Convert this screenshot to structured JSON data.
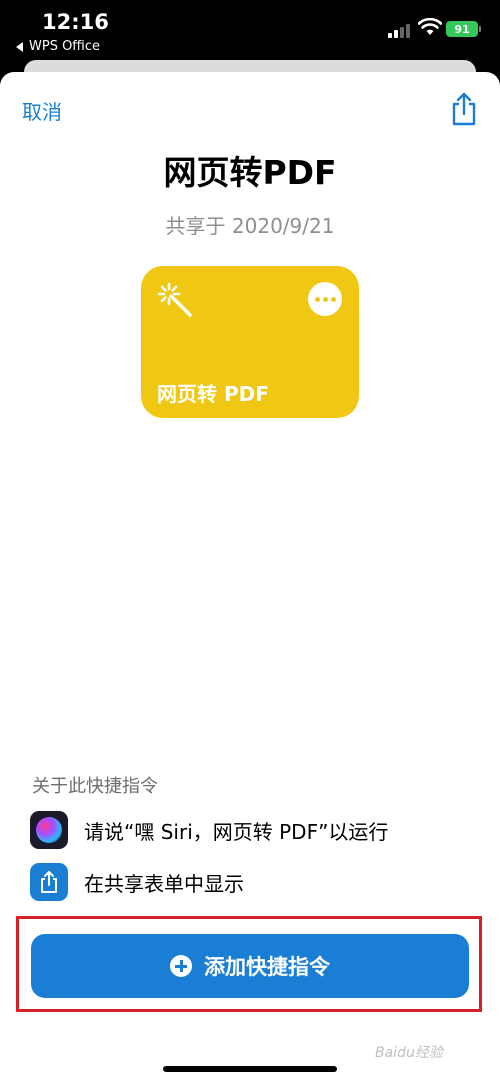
{
  "status_bar": {
    "time": "12:16",
    "back_app": "WPS Office",
    "battery": "91"
  },
  "nav": {
    "cancel": "取消",
    "share_icon": "share-icon"
  },
  "shortcut": {
    "title": "网页转PDF",
    "shared_on": "共享于 2020/9/21",
    "card_name": "网页转 PDF",
    "card_color": "#f0c814",
    "card_icon": "magic-wand-icon",
    "more_icon": "ellipsis-icon"
  },
  "about": {
    "header": "关于此快捷指令",
    "rows": [
      {
        "icon": "siri-icon",
        "text": "请说“嘿 Siri，网页转 PDF”以运行"
      },
      {
        "icon": "share-sheet-icon",
        "text": "在共享表单中显示"
      }
    ]
  },
  "action": {
    "add_label": "添加快捷指令",
    "accent": "#1a7fd4"
  },
  "watermark": "Baidu经验"
}
